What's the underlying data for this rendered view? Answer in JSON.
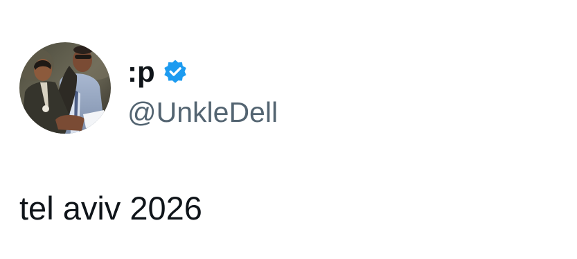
{
  "author": {
    "display_name": ":p",
    "handle": "@UnkleDell",
    "verified": true,
    "badge_color": "#1d9bf0"
  },
  "tweet": {
    "text": "tel aviv 2026"
  },
  "icons": {
    "verified": "verified-badge-icon"
  },
  "colors": {
    "text_primary": "#0f1419",
    "text_secondary": "#536471",
    "background": "#ffffff"
  }
}
